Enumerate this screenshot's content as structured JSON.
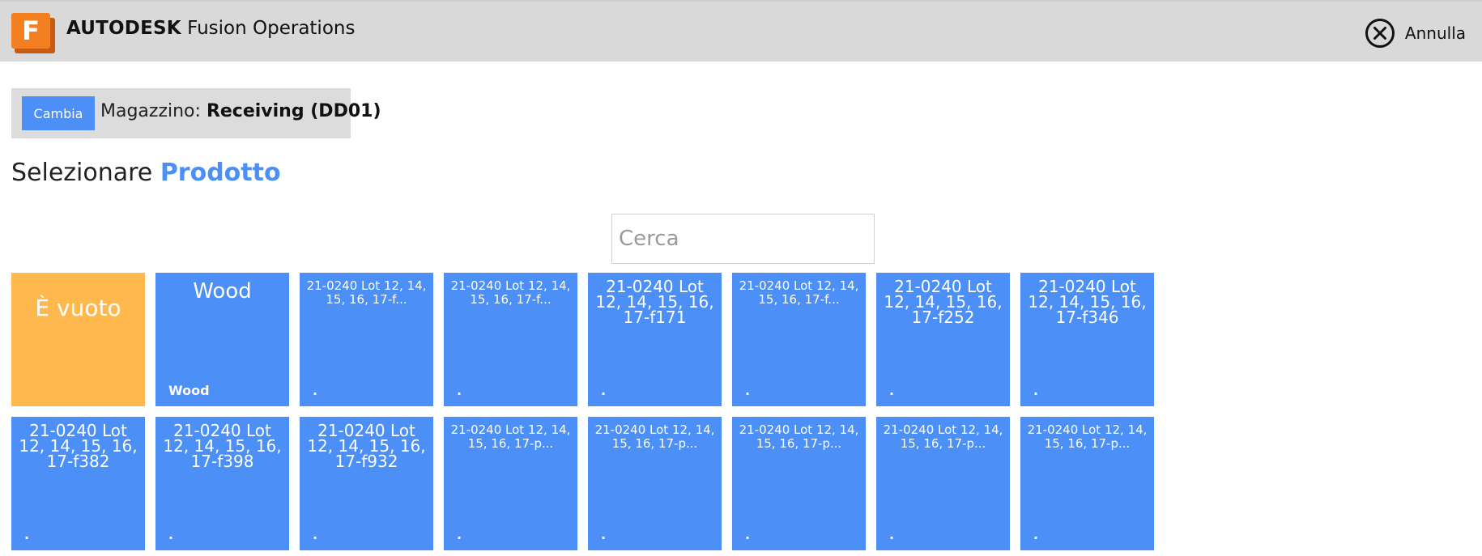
{
  "header": {
    "logo_letter": "F",
    "brand_bold": "AUTODESK",
    "brand_rest": "Fusion Operations",
    "cancel_label": "Annulla",
    "accent_color": "#f47f20"
  },
  "warehouse": {
    "change_label": "Cambia",
    "label": "Magazzino:",
    "value": "Receiving (DD01)"
  },
  "title": {
    "prefix": "Selezionare",
    "accent": "Prodotto"
  },
  "search": {
    "placeholder": "Cerca",
    "value": ""
  },
  "tiles": [
    {
      "title": "È vuoto",
      "sub": "",
      "style": "empty"
    },
    {
      "title": "Wood",
      "sub": "Wood",
      "style": "wood"
    },
    {
      "title": "21-0240 Lot 12, 14, 15, 16, 17-f...",
      "sub": ".",
      "style": "small"
    },
    {
      "title": "21-0240 Lot 12, 14, 15, 16, 17-f...",
      "sub": ".",
      "style": "small"
    },
    {
      "title": "21-0240 Lot 12, 14, 15, 16, 17-f171",
      "sub": ".",
      "style": "large"
    },
    {
      "title": "21-0240 Lot 12, 14, 15, 16, 17-f...",
      "sub": ".",
      "style": "small"
    },
    {
      "title": "21-0240 Lot 12, 14, 15, 16, 17-f252",
      "sub": ".",
      "style": "large"
    },
    {
      "title": "21-0240 Lot 12, 14, 15, 16, 17-f346",
      "sub": ".",
      "style": "large"
    },
    {
      "title": "21-0240 Lot 12, 14, 15, 16, 17-f382",
      "sub": ".",
      "style": "large"
    },
    {
      "title": "21-0240 Lot 12, 14, 15, 16, 17-f398",
      "sub": ".",
      "style": "large"
    },
    {
      "title": "21-0240 Lot 12, 14, 15, 16, 17-f932",
      "sub": ".",
      "style": "large"
    },
    {
      "title": "21-0240 Lot 12, 14, 15, 16, 17-p...",
      "sub": ".",
      "style": "small"
    },
    {
      "title": "21-0240 Lot 12, 14, 15, 16, 17-p...",
      "sub": ".",
      "style": "small"
    },
    {
      "title": "21-0240 Lot 12, 14, 15, 16, 17-p...",
      "sub": ".",
      "style": "small"
    },
    {
      "title": "21-0240 Lot 12, 14, 15, 16, 17-p...",
      "sub": ".",
      "style": "small"
    },
    {
      "title": "21-0240 Lot 12, 14, 15, 16, 17-p...",
      "sub": ".",
      "style": "small"
    }
  ],
  "colors": {
    "tile_blue": "#4b8ff7",
    "tile_empty": "#ffb84d",
    "header_bg": "#d9d9d9"
  }
}
